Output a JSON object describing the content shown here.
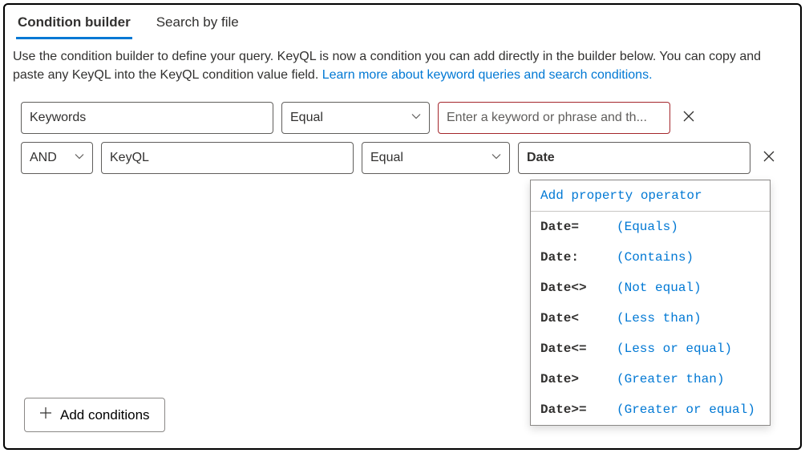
{
  "tabs": {
    "condition_builder": "Condition builder",
    "search_by_file": "Search by file"
  },
  "description": {
    "text1": "Use the condition builder to define your query. KeyQL is now a condition you can add directly in the builder below. You can copy and paste any KeyQL into the KeyQL condition value field. ",
    "link": "Learn more about keyword queries and search conditions."
  },
  "row1": {
    "property": "Keywords",
    "operator": "Equal",
    "value_placeholder": "Enter a keyword or phrase and th..."
  },
  "row2": {
    "logic": "AND",
    "property": "KeyQL",
    "operator": "Equal",
    "value": "Date"
  },
  "dropdown": {
    "header": "Add property operator",
    "items": [
      {
        "key": "Date=",
        "desc": "(Equals)"
      },
      {
        "key": "Date:",
        "desc": "(Contains)"
      },
      {
        "key": "Date<>",
        "desc": "(Not equal)"
      },
      {
        "key": "Date<",
        "desc": "(Less than)"
      },
      {
        "key": "Date<=",
        "desc": "(Less or equal)"
      },
      {
        "key": "Date>",
        "desc": "(Greater than)"
      },
      {
        "key": "Date>=",
        "desc": "(Greater or equal)"
      }
    ]
  },
  "add_conditions": "Add conditions"
}
